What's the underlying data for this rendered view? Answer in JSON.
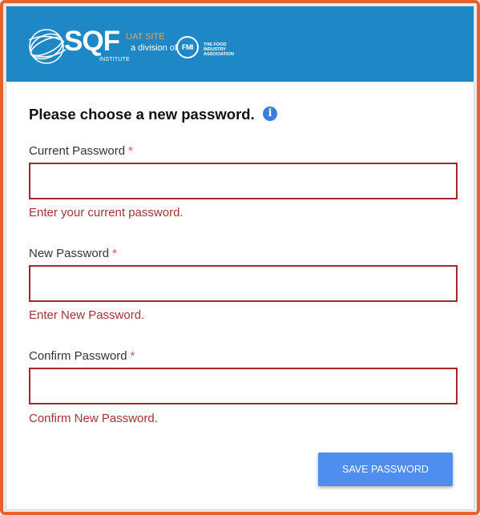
{
  "header": {
    "brand": "SQF",
    "brand_sub": "INSTITUTE",
    "uat_label": "UAT SITE",
    "division_label": "a division of",
    "partner_logo_text": "FMI",
    "partner_name": "THE FOOD INDUSTRY ASSOCIATION",
    "colors": {
      "bar": "#1e88c6",
      "uat": "#f0a24a"
    }
  },
  "form": {
    "title": "Please choose a new password.",
    "info_icon": "info-icon",
    "required_marker": "*",
    "fields": [
      {
        "label": "Current Password",
        "value": "",
        "error": "Enter your current password."
      },
      {
        "label": "New Password",
        "value": "",
        "error": "Enter New Password."
      },
      {
        "label": "Confirm Password",
        "value": "",
        "error": "Confirm New Password."
      }
    ],
    "save_label": "SAVE PASSWORD"
  },
  "colors": {
    "accent": "#4f8def",
    "error": "#a23434",
    "frame": "#e8622f"
  }
}
